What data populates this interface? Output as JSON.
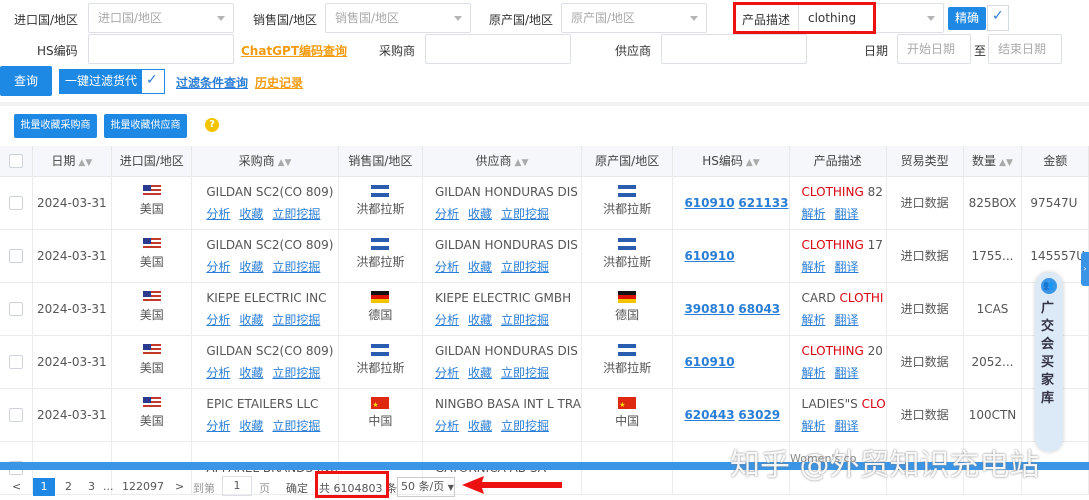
{
  "filters": {
    "import_country_label": "进口国/地区",
    "import_country_placeholder": "进口国/地区",
    "sales_country_label": "销售国/地区",
    "sales_country_placeholder": "销售国/地区",
    "origin_country_label": "原产国/地区",
    "origin_country_placeholder": "原产国/地区",
    "product_desc_label": "产品描述",
    "product_desc_value": "clothing",
    "precise_label": "精确",
    "hs_label": "HS编码",
    "chatgpt_link": "ChatGPT编码查询",
    "buyer_label": "采购商",
    "supplier_label": "供应商",
    "date_label": "日期",
    "start_date_placeholder": "开始日期",
    "to_label": "至",
    "end_date_placeholder": "结束日期",
    "query_button": "查询",
    "one_key_filter_label": "一键过滤货代",
    "filter_query_link": "过滤条件查询",
    "history_link": "历史记录"
  },
  "batch": {
    "collect_buyers": "批量收藏采购商",
    "collect_suppliers": "批量收藏供应商"
  },
  "table": {
    "headers": [
      "日期",
      "进口国/地区",
      "采购商",
      "销售国/地区",
      "供应商",
      "原产国/地区",
      "HS编码",
      "产品描述",
      "贸易类型",
      "数量",
      "金额"
    ],
    "actions": [
      "分析",
      "收藏",
      "立即挖掘"
    ],
    "desc_actions": [
      "解析",
      "翻译"
    ],
    "rows": [
      {
        "date": "2024-03-31",
        "import_country": "美国",
        "buyer": "GILDAN SC2(CO 809)",
        "sales_country": "洪都拉斯",
        "supplier": "GILDAN HONDURAS DIS",
        "origin": "洪都拉斯",
        "hs": "610910",
        "hs2": "621133",
        "desc_a": "CLOTHING",
        "desc_b": " 82",
        "trade": "进口数据",
        "qty": "825BOX",
        "amount": "97547U"
      },
      {
        "date": "2024-03-31",
        "import_country": "美国",
        "buyer": "GILDAN SC2(CO 809)",
        "sales_country": "洪都拉斯",
        "supplier": "GILDAN HONDURAS DIS",
        "origin": "洪都拉斯",
        "hs": "610910",
        "hs2": "",
        "desc_a": "CLOTHING",
        "desc_b": " 17",
        "trade": "进口数据",
        "qty": "1755...",
        "amount": "145557U"
      },
      {
        "date": "2024-03-31",
        "import_country": "美国",
        "buyer": "KIEPE ELECTRIC INC",
        "sales_country": "德国",
        "supplier": "KIEPE ELECTRIC GMBH",
        "origin": "德国",
        "hs": "390810",
        "hs2": "68043",
        "desc_a": "CARD ",
        "desc_b": "CLOTHI",
        "trade": "进口数据",
        "qty": "1CAS",
        "amount": ""
      },
      {
        "date": "2024-03-31",
        "import_country": "美国",
        "buyer": "GILDAN SC2(CO 809)",
        "sales_country": "洪都拉斯",
        "supplier": "GILDAN HONDURAS DIS",
        "origin": "洪都拉斯",
        "hs": "610910",
        "hs2": "",
        "desc_a": "CLOTHING",
        "desc_b": " 20",
        "trade": "进口数据",
        "qty": "2052...",
        "amount": ""
      },
      {
        "date": "2024-03-31",
        "import_country": "美国",
        "buyer": "EPIC ETAILERS LLC",
        "sales_country": "中国",
        "supplier": "NINGBO BASA INT L TRA",
        "origin": "中国",
        "hs": "620443",
        "hs2": "63029",
        "desc_a": "LADIES\"S ",
        "desc_b": "CLO",
        "trade": "进口数据",
        "qty": "100CTN",
        "amount": ""
      },
      {
        "date": "",
        "import_country": "",
        "buyer": "APPAREL BRANDS INC",
        "sales_country": "",
        "supplier": "GATORNICA AB SA",
        "origin": "",
        "hs": "",
        "hs2": "",
        "desc_a": "",
        "desc_b": "",
        "trade": "",
        "qty": "",
        "amount": ""
      }
    ]
  },
  "pager": {
    "prev": "<",
    "page1": "1",
    "page2": "2",
    "page3": "3",
    "ellipsis": "...",
    "last": "122097",
    "next": ">",
    "goto_label": "到第",
    "goto_value": "1",
    "page_unit": "页",
    "confirm": "确定",
    "total": "共 6104803 条",
    "page_size": "50 条/页"
  },
  "side_widget": {
    "text": "广交会买家库"
  },
  "watermark": "知乎 @外贸知识充电站",
  "footer_partial": "Women's co"
}
